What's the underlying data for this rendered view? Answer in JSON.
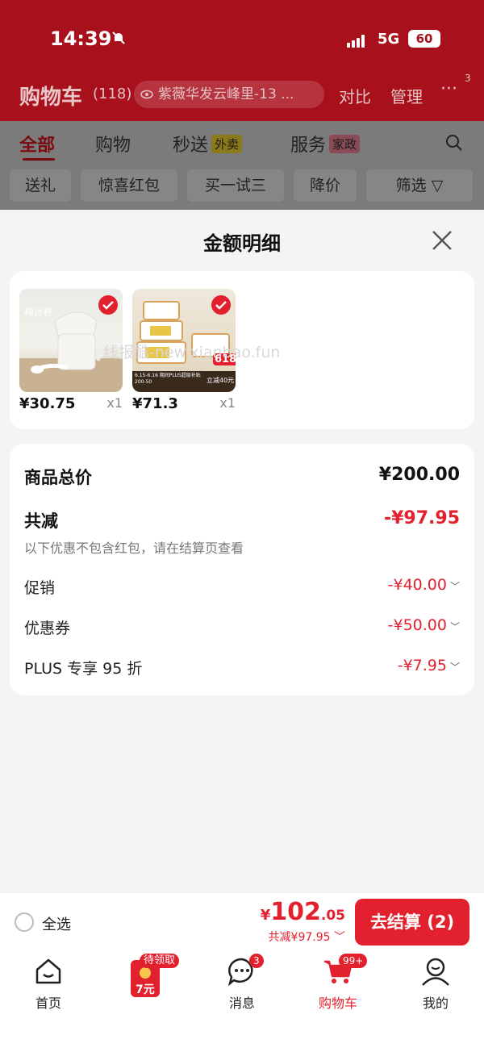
{
  "status_bar": {
    "time": "14:39",
    "network": "5G",
    "battery": "60"
  },
  "header": {
    "title": "购物车",
    "count": "(118)",
    "address": "紫薇华发云峰里-13 ...",
    "compare": "对比",
    "manage": "管理",
    "more_badge": "3"
  },
  "tabs": {
    "all": "全部",
    "shop": "购物",
    "express": "秒送",
    "express_tag": "外卖",
    "service": "服务",
    "service_tag": "家政"
  },
  "chips": [
    "送礼",
    "惊喜红包",
    "买一试三",
    "降价",
    "筛选"
  ],
  "sheet": {
    "title": "金额明细",
    "watermark": "线报酷-new.xianbao.fun",
    "products": [
      {
        "price": "¥30.75",
        "qty": "x1",
        "img_text": "榨汁杯"
      },
      {
        "price": "¥71.3",
        "qty": "x1",
        "img_badge": "618",
        "img_note": "6.15-6.16 期间PLUS超级补贴200-50",
        "img_sub": "立减40元"
      }
    ],
    "summary": {
      "total_label": "商品总价",
      "total_value": "¥200.00",
      "reduce_label": "共减",
      "reduce_value": "-¥97.95",
      "note": "以下优惠不包含红包，请在结算页查看",
      "items": [
        {
          "label": "促销",
          "value": "-¥40.00"
        },
        {
          "label": "优惠券",
          "value": "-¥50.00"
        },
        {
          "label": "PLUS 专享 95 折",
          "value": "-¥7.95"
        }
      ]
    }
  },
  "checkout": {
    "select_all": "全选",
    "yen": "¥",
    "total_int": "102",
    "total_dec": ".05",
    "discount": "共减¥97.95",
    "pay_button": "去结算 (2)"
  },
  "nav": {
    "home": "首页",
    "promo_tag": "待领取",
    "promo_amount": "7元",
    "messages": "消息",
    "messages_badge": "3",
    "cart": "购物车",
    "cart_badge": "99+",
    "mine": "我的"
  },
  "colors": {
    "accent": "#e3202d",
    "header_bg": "#a8111c"
  }
}
